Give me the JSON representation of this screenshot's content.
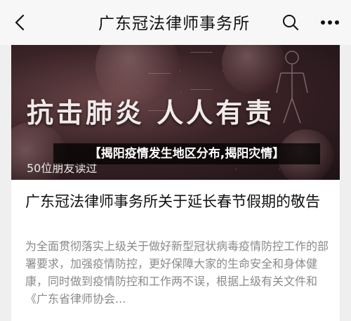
{
  "nav": {
    "title": "广东冠法律师事务所",
    "back_icon": "chevron-left-icon",
    "search_icon": "search-icon",
    "more_icon": "more-dots-icon"
  },
  "article": {
    "cover_headline": "抗击肺炎 人人有责",
    "readers": "50位朋友读过",
    "overlay_title": "【揭阳疫情发生地区分布,揭阳灾情】",
    "title": "广东冠法律师事务所关于延长春节假期的敬告",
    "summary": "为全面贯彻落实上级关于做好新型冠状病毒疫情防控工作的部署要求，加强疫情防控，更好保障大家的生命安全和身体健康，同时做到疫情防控和工作两不误，根据上级有关文件和《广东省律师协会..."
  }
}
